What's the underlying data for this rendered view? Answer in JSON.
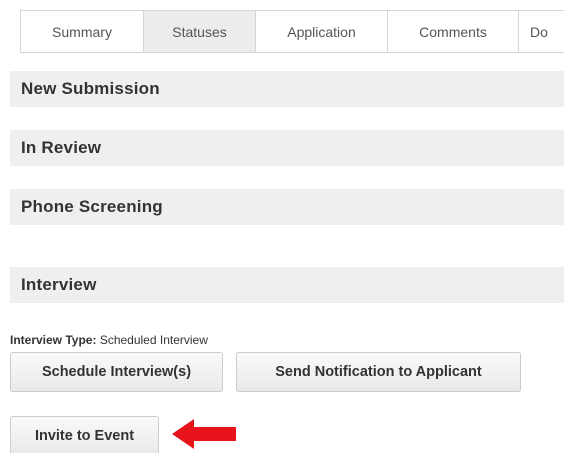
{
  "tabs": [
    {
      "label": "Summary",
      "active": false
    },
    {
      "label": "Statuses",
      "active": true
    },
    {
      "label": "Application",
      "active": false
    },
    {
      "label": "Comments",
      "active": false
    },
    {
      "label": "Do",
      "active": false
    }
  ],
  "statuses": [
    {
      "label": "New Submission"
    },
    {
      "label": "In Review"
    },
    {
      "label": "Phone Screening"
    },
    {
      "label": "Interview"
    }
  ],
  "interview": {
    "type_label": "Interview Type:",
    "type_value": "Scheduled Interview"
  },
  "actions": {
    "schedule_label": "Schedule Interview(s)",
    "notify_label": "Send Notification to Applicant",
    "invite_label": "Invite to Event"
  },
  "colors": {
    "arrow": "#e8141c",
    "status_bar_bg": "#efefef",
    "active_tab_bg": "#ececec"
  },
  "icons": {
    "arrow": "left-arrow-icon"
  }
}
